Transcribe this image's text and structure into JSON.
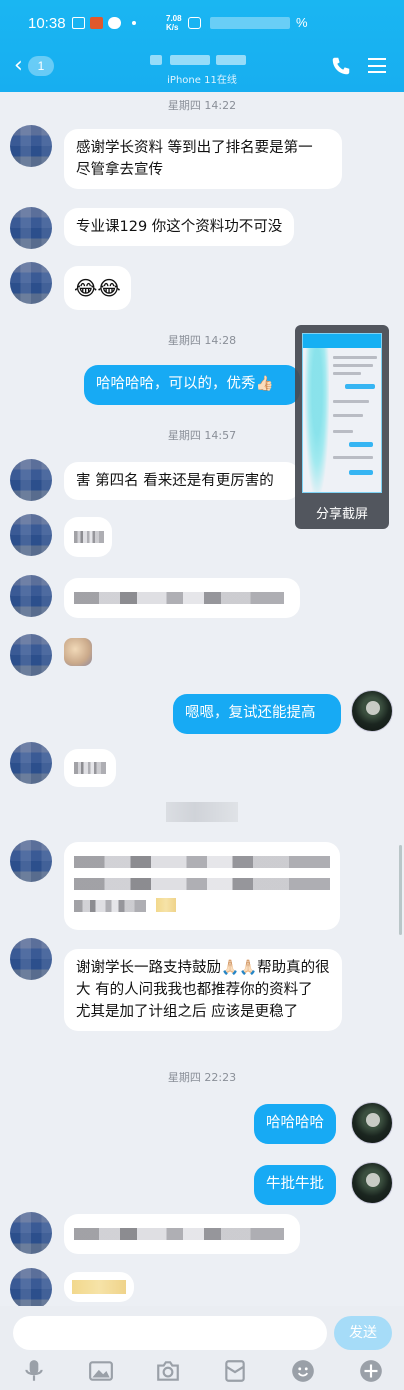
{
  "status": {
    "time": "10:38",
    "speed": "7.08\nK/s",
    "battery": "%"
  },
  "header": {
    "badge": "1",
    "subtitle": "iPhone 11在线"
  },
  "timestamps": [
    "星期四 14:22",
    "星期四 14:28",
    "星期四 14:57",
    "星期四 22:23"
  ],
  "messages": {
    "m1": "感谢学长资料 等到出了排名要是第一 尽管拿去宣传",
    "m2": "专业课129 你这个资料功不可没",
    "m3": "😂😂",
    "m4": "哈哈哈哈，可以的，优秀👍🏻",
    "m5": "害 第四名 看来还是有更厉害的",
    "m6": "嗯嗯，复试还能提高",
    "m7": "谢谢学长一路支持鼓励🙏🏻🙏🏻帮助真的很大 有的人问我我也都推荐你的资料了 尤其是加了计组之后 应该是更稳了",
    "m8": "哈哈哈哈",
    "m9": "牛批牛批"
  },
  "share": {
    "label": "分享截屏"
  },
  "input": {
    "send_label": "发送"
  },
  "icons": {
    "back": "chevron-left-icon",
    "phone": "phone-icon",
    "menu": "menu-icon",
    "mic": "microphone-icon",
    "image": "image-icon",
    "camera": "camera-icon",
    "redpacket": "red-packet-icon",
    "emoji": "emoji-icon",
    "plus": "plus-icon"
  }
}
